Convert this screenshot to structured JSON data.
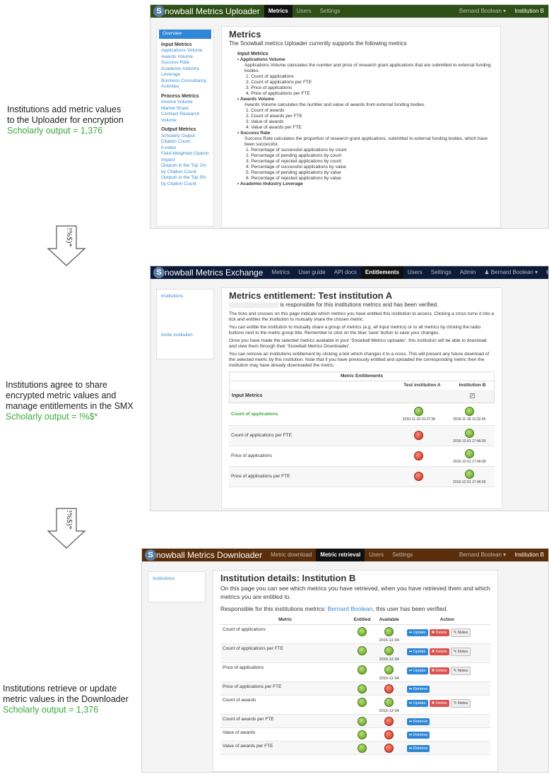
{
  "captions": {
    "c1_line1": "Institutions add metric values",
    "c1_line2": "to the Uploader for encryption",
    "c1_output": "Scholarly output = 1,376",
    "c2_line1": "Institutions agree to share",
    "c2_line2": "encrypted metric values and",
    "c2_line3": "manage entitlements in the SMX",
    "c2_output": "Scholarly output = !%$*",
    "c3_line1": "Institutions retrieve or update",
    "c3_line2": "metric values in the Downloader",
    "c3_output": "Scholarly output = 1,376",
    "arrow_label": "!%$)*"
  },
  "uploader": {
    "brand": "nowball Metrics Uploader",
    "nav": [
      "Metrics",
      "Users",
      "Settings"
    ],
    "user": "Bernard Boolean",
    "inst": "Institution B",
    "side_active": "Overview",
    "side_input_head": "Input Metrics",
    "side_input": [
      "Applications Volume",
      "Awards Volume",
      "Success Rate",
      "Academic-Industry Leverage",
      "Business Consultancy Activities"
    ],
    "side_process_head": "Process Metrics",
    "side_process": [
      "Income Volume",
      "Market Share",
      "Contract Research Volume"
    ],
    "side_output_head": "Output Metrics",
    "side_output": [
      "Scholarly Output",
      "Citation Count",
      "h-index",
      "Field-Weighted Citation Impact",
      "Outputs in the Top 1% by Citation Count",
      "Outputs in the Top 5% by Citation Count"
    ],
    "title": "Metrics",
    "intro": "The Snowball metrics Uploader currently supports the following metrics",
    "input_head": "Input Metrics",
    "m1": "Applications Volume",
    "m1_desc": "Applications Volume calculates the number and price of research grant applications that are submitted to external funding bodies.",
    "m1_list": [
      "1. Count of applications",
      "2. Count of applications per FTE",
      "3. Price of applications",
      "4. Price of applications per FTE"
    ],
    "m2": "Awards Volume",
    "m2_desc": "Awards Volume calculates the number and value of awards from external funding bodies.",
    "m2_list": [
      "1. Count of awards",
      "2. Count of awards per FTE",
      "3. Value of awards",
      "4. Value of awards per FTE"
    ],
    "m3": "Success Rate",
    "m3_desc": "Success Rate calculates the proportion of research grant applications, submitted to external funding bodies, which have been successful.",
    "m3_list": [
      "1. Percentage of successful applications by count",
      "2. Percentage of pending applications by count",
      "3. Percentage of rejected applications by count",
      "4. Percentage of successful applications by value",
      "5. Percentage of pending applications by value",
      "6. Percentage of rejected applications by value"
    ],
    "m4": "Academic-Industry Leverage"
  },
  "exchange": {
    "brand": "nowball Metrics Exchange",
    "nav": [
      "Metrics",
      "User guide",
      "API docs",
      "Entitlements",
      "Users",
      "Settings",
      "Admin"
    ],
    "user": "Bernard Boolean",
    "inst": "Institution B",
    "side_link1": "Institutions",
    "side_link2": "Invite institution",
    "title": "Metrics entitlement: Test institution A",
    "verified": "is responsible for this institutions metrics and has been verified.",
    "p1": "The ticks and crosses on this page indicate which metrics you have entitled this institution to access. Clicking a cross turns it into a tick and entitles the institution to mutually share the chosen metric.",
    "p2": "You can entitle the institution to mutually share a group of metrics (e.g. all input metrics) or to all metrics by clicking the radio buttons next to the metric group title. Remember to click on the blue 'save' button to save your changes.",
    "p3": "Once you have made the selected metrics available in your 'Snowball Metrics uploader', this institution will be able to download and view them through their 'Snowball Metrics Downloader'.",
    "p4": "You can remove an institutions entitlement by clicking a tick which changes it to a cross. This will present any future download of the selected metric by this institution. Note that if you have previously entitled and uploaded the corresponding metric then the institution may have already downloaded the metric.",
    "table_title": "Metric Entitlements",
    "colA": "Test institution A",
    "colB": "Institution B",
    "group": "Input Metrics",
    "rows": [
      {
        "name": "Count of applications",
        "a": "ok",
        "a_date": "2016-11-18 15:27:38",
        "b": "ok",
        "b_date": "2016-11-18 12:32:45",
        "green": true
      },
      {
        "name": "Count of applications per FTE",
        "a": "no",
        "a_date": "",
        "b": "ok",
        "b_date": "2016-12-01 17:46:09",
        "green": false
      },
      {
        "name": "Price of applications",
        "a": "no",
        "a_date": "",
        "b": "ok",
        "b_date": "2016-12-01 17:46:09",
        "green": false
      },
      {
        "name": "Price of applications per FTE",
        "a": "no",
        "a_date": "",
        "b": "ok",
        "b_date": "2016-12-01 17:46:09",
        "green": false
      }
    ]
  },
  "downloader": {
    "brand": "nowball Metrics Downloader",
    "nav": [
      "Metric download",
      "Metric retrieval",
      "Users",
      "Settings"
    ],
    "user": "Bernard Boolean",
    "inst": "Institution B",
    "side_link": "Institutions",
    "title": "Institution details: Institution B",
    "p1": "On this page you can see which metrics you have retrieved, when you have retrieved them and which metrics you are entitled to.",
    "resp": "Responsible for this institutions metrics:",
    "resp_name": "Bernard Boolean",
    "resp_tail": ", this user has been verified.",
    "h_metric": "Metric",
    "h_entitled": "Entitled",
    "h_available": "Available",
    "h_action": "Action",
    "btn_update": "Update",
    "btn_delete": "Delete",
    "btn_notes": "Notes",
    "btn_retrieve": "Retrieve",
    "rows": [
      {
        "name": "Count of applications",
        "avail": "ok",
        "date": "2016-12-04",
        "mode": "update"
      },
      {
        "name": "Count of applications per FTE",
        "avail": "ok",
        "date": "2016-12-04",
        "mode": "update"
      },
      {
        "name": "Price of applications",
        "avail": "ok",
        "date": "2016-12-04",
        "mode": "update"
      },
      {
        "name": "Price of applications per FTE",
        "avail": "no",
        "date": "",
        "mode": "retrieve"
      },
      {
        "name": "Count of awards",
        "avail": "ok",
        "date": "2016-12-04",
        "mode": "update"
      },
      {
        "name": "Count of awards per FTE",
        "avail": "no",
        "date": "",
        "mode": "retrieve"
      },
      {
        "name": "Value of awards",
        "avail": "no",
        "date": "",
        "mode": "retrieve"
      },
      {
        "name": "Value of awards per FTE",
        "avail": "no",
        "date": "",
        "mode": "retrieve"
      }
    ]
  },
  "colors": {
    "green_text": "#3aa93a",
    "uploader_nav": "#2d5016",
    "exchange_nav": "#0d1b3a",
    "downloader_nav": "#5a2e0a"
  }
}
